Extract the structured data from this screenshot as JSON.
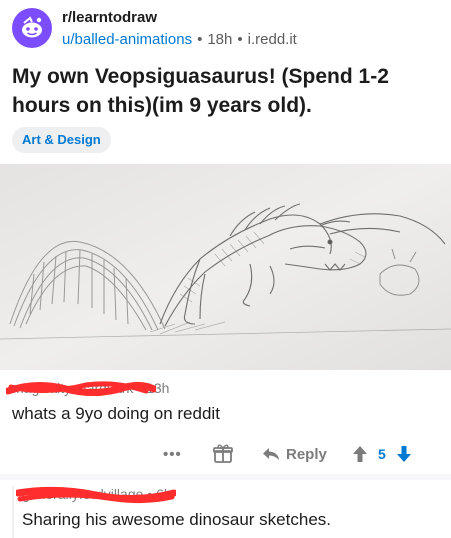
{
  "post": {
    "subreddit": "r/learntodraw",
    "author": "u/balled-animations",
    "age": "18h",
    "domain": "i.redd.it",
    "title": "My own Veopsiguasaurus! (Spend 1-2 hours on this)(im 9 years old).",
    "flair": "Art & Design"
  },
  "comments": [
    {
      "author": "magicaltynaardvark",
      "age": "13h",
      "body": "whats a 9yo doing on reddit"
    },
    {
      "author": "generallyfowlvillage",
      "age": "6h",
      "body": "Sharing his awesome dinosaur sketches."
    }
  ],
  "actions": {
    "more": "•••",
    "reply": "Reply",
    "score": "5"
  },
  "colors": {
    "accent": "#0079d3",
    "avatar": "#7c4dff",
    "redaction": "#ff2d2d",
    "upvote": "#7c7c7c",
    "downvote": "#0079d3"
  },
  "icons": {
    "subreddit_avatar": "reddit-snoo-icon",
    "award": "gift-icon",
    "reply": "reply-arrow-icon",
    "upvote": "upvote-arrow-icon",
    "downvote": "downvote-arrow-icon"
  }
}
